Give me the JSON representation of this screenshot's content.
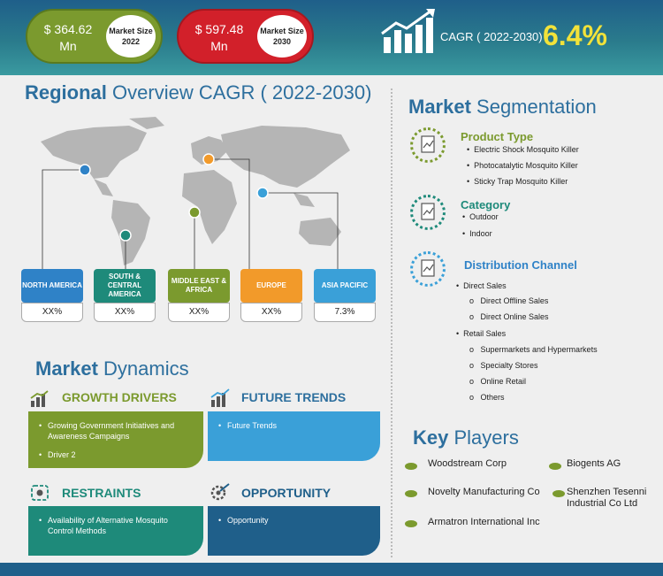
{
  "header": {
    "market2022_value": "$ 364.62 Mn",
    "market2022_label": "Market Size 2022",
    "market2030_value": "$ 597.48 Mn",
    "market2030_label": "Market Size 2030",
    "cagr_label": "CAGR ( 2022-2030)",
    "cagr_value": "6.4%"
  },
  "regional": {
    "title_bold": "Regional",
    "title_rest": " Overview CAGR ( 2022-2030)",
    "regions": [
      {
        "name": "NORTH AMERICA",
        "value": "XX%",
        "color": "#2f82c7"
      },
      {
        "name": "SOUTH & CENTRAL AMERICA",
        "value": "XX%",
        "color": "#1e8a7a"
      },
      {
        "name": "MIDDLE EAST & AFRICA",
        "value": "XX%",
        "color": "#7b9a2e"
      },
      {
        "name": "EUROPE",
        "value": "XX%",
        "color": "#f29a2a"
      },
      {
        "name": "ASIA PACIFIC",
        "value": "7.3%",
        "color": "#3aa0d8"
      }
    ]
  },
  "dynamics": {
    "title_bold": "Market",
    "title_rest": " Dynamics",
    "growth": {
      "label": "GROWTH DRIVERS",
      "items": [
        "Growing Government Initiatives and Awareness Campaigns",
        "Driver 2"
      ]
    },
    "trends": {
      "label": "FUTURE TRENDS",
      "items": [
        "Future Trends"
      ]
    },
    "restraints": {
      "label": "RESTRAINTS",
      "items": [
        "Availability of Alternative Mosquito Control Methods"
      ]
    },
    "opportunity": {
      "label": "OPPORTUNITY",
      "items": [
        "Opportunity"
      ]
    }
  },
  "segmentation": {
    "title_bold": "Market",
    "title_rest": " Segmentation",
    "product_type": {
      "label": "Product Type",
      "items": [
        "Electric Shock Mosquito Killer",
        "Photocatalytic Mosquito Killer",
        "Sticky Trap Mosquito Killer"
      ]
    },
    "category": {
      "label": "Category",
      "items": [
        "Outdoor",
        "Indoor"
      ]
    },
    "distribution": {
      "label": "Distribution Channel",
      "direct": "Direct Sales",
      "direct_items": [
        "Direct Offline Sales",
        "Direct Online Sales"
      ],
      "retail": "Retail Sales",
      "retail_items": [
        "Supermarkets and Hypermarkets",
        "Specialty Stores",
        "Online Retail",
        "Others"
      ]
    }
  },
  "key_players": {
    "title_bold": "Key",
    "title_rest": " Players",
    "players": [
      "Woodstream Corp",
      "Biogents AG",
      "Novelty Manufacturing Co",
      "Shenzhen Tesenni Industrial Co Ltd",
      "Armatron International Inc"
    ]
  }
}
